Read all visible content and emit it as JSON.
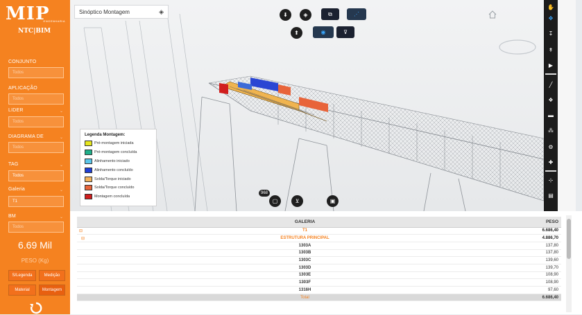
{
  "sidebar": {
    "logo_text": "MIP",
    "logo_sub": "ENGENHARIA",
    "product": "NTC|BIM",
    "fields": [
      {
        "label": "CONJUNTO",
        "value": "Todos"
      },
      {
        "label": "APLICAÇÃO",
        "value": "Todos"
      },
      {
        "label": "LIDER",
        "value": "Todos"
      },
      {
        "label": "DIAGRAMA DE",
        "value": "Todos"
      },
      {
        "label": "TAG",
        "value": "Todos"
      },
      {
        "label": "Galeria",
        "value": "T1"
      },
      {
        "label": "BM",
        "value": "Todos"
      }
    ],
    "stat_value": "6.69 Mil",
    "stat_label": "PESO (Kg)",
    "buttons": [
      "S/Legenda",
      "Medição",
      "Material",
      "Montagem"
    ]
  },
  "viewer": {
    "title": "Sinóptico Montagem",
    "legend_title": "Legenda Montagem:",
    "legend": [
      {
        "label": "Pré-montagem iniciada",
        "color": "#e6e61e"
      },
      {
        "label": "Pré-montagem concluída",
        "color": "#1fb08a"
      },
      {
        "label": "Alinhamento iniciado",
        "color": "#5bc7ea"
      },
      {
        "label": "Alinhamento concluído",
        "color": "#1f3fd6"
      },
      {
        "label": "Solda/Torque iniciado",
        "color": "#f3b35b"
      },
      {
        "label": "Solda/Torque concluído",
        "color": "#e8643a"
      },
      {
        "label": "Montagem concluída",
        "color": "#d11e1e"
      }
    ],
    "count_badge": "968"
  },
  "table": {
    "headers": {
      "name": "GALERIA",
      "peso": "PESO"
    },
    "rows": [
      {
        "name": "T1",
        "peso": "6.686,40",
        "group": true
      },
      {
        "name": "ESTRUTURA PRINCIPAL",
        "peso": "4.886,70",
        "group": true
      },
      {
        "name": "1303A",
        "peso": "137,80"
      },
      {
        "name": "1303B",
        "peso": "137,80"
      },
      {
        "name": "1303C",
        "peso": "139,60"
      },
      {
        "name": "1303D",
        "peso": "139,70"
      },
      {
        "name": "1303E",
        "peso": "108,90"
      },
      {
        "name": "1303F",
        "peso": "108,90"
      },
      {
        "name": "1316H",
        "peso": "97,60"
      }
    ],
    "total_label": "Total",
    "total_peso": "6.686,40"
  }
}
